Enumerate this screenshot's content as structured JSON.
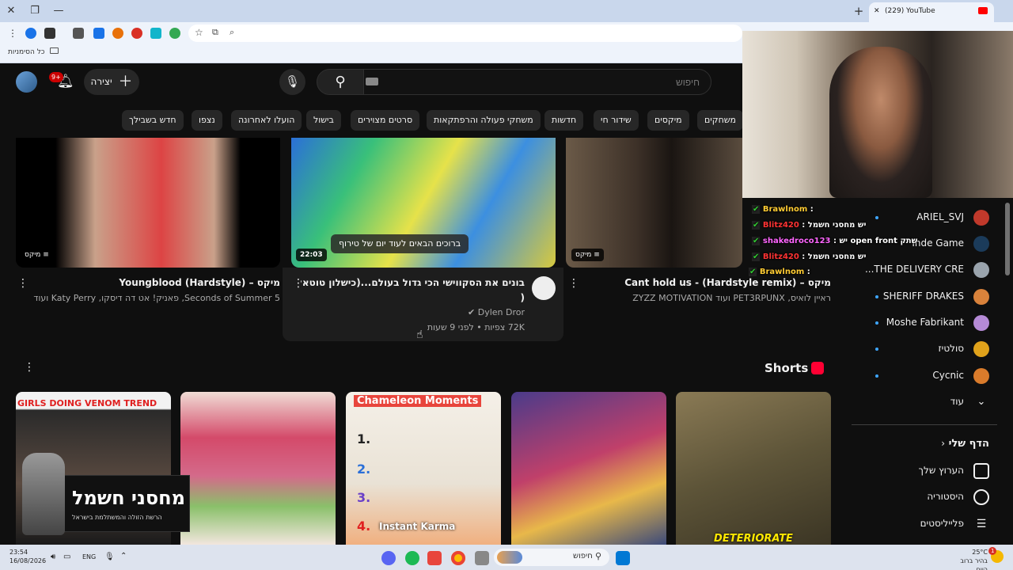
{
  "browser": {
    "tab_title": "(229) YouTube",
    "bookmarks_label": "כל הסימניות"
  },
  "header": {
    "create_label": "יצירה",
    "notification_count": "9+",
    "search_placeholder": "חיפוש"
  },
  "chips": [
    "משחקים",
    "מיקסים",
    "שידור חי",
    "חדשות",
    "משחקי פעולה והרפתקאות",
    "סרטים מצוירים",
    "בישול",
    "הועלו לאחרונה",
    "נצפו",
    "חדש בשבילך"
  ],
  "videos": [
    {
      "title": "מיקס – Cant hold us - (Hardstyle remix)",
      "subtitle": "ראיין לואיס, PET3RPUNX ועוד ZYZZ MOTIVATION",
      "badge": "מיקס"
    },
    {
      "title": "בונים את הסקווישי הכי גדול בעולם...(כישלון טוטאלי",
      "title2": "(",
      "channel": "Dylen Dror",
      "meta": "72K צפיות • לפני 9 שעות",
      "duration": "22:03",
      "caption": "ברוכים הבאים לעוד יום של טירוף"
    },
    {
      "title": "מיקס – Youngblood (Hardstyle)",
      "subtitle": "5 Seconds of Summer, פאניק! אט דה דיסקו, Katy Perry ועוד",
      "badge": "מיקס"
    }
  ],
  "shorts": {
    "title": "Shorts",
    "items": [
      {
        "overlay": "DETERIORATE"
      },
      {
        "overlay": ""
      },
      {
        "overlay_top": "Chameleon Moments",
        "overlay_bottom": "Instant Karma",
        "nums": [
          "1.",
          "2.",
          "3.",
          "4."
        ]
      },
      {
        "overlay": ""
      },
      {
        "overlay": "GIRLS DOING VENOM TREND",
        "promo_big": "מחסני חשמל",
        "promo_small": "הרשת הזולה והמשתלמת בישראל"
      }
    ]
  },
  "sidebar": {
    "subscriptions": [
      {
        "label": "ARIEL_SVJ",
        "color": "#c0392b"
      },
      {
        "label": "Inde Game",
        "color": "#1b3b5a"
      },
      {
        "label": "THE DELIVERY CRE...",
        "color": "#9aa4ad"
      },
      {
        "label": "SHERIFF DRAKES",
        "color": "#d9823b"
      },
      {
        "label": "Moshe Fabrikant",
        "color": "#b58ad6"
      },
      {
        "label": "סולטיז",
        "color": "#e0a21b"
      },
      {
        "label": "Cycnic",
        "color": "#d97b2b"
      }
    ],
    "more_label": "עוד",
    "you_title": "הדף שלי",
    "you_items": [
      "הערוץ שלך",
      "היסטוריה",
      "פלייליסטים"
    ]
  },
  "stream_chat": [
    {
      "user": "Brawlnom",
      "text": "",
      "color": "#ffcc33"
    },
    {
      "user": "Blitz420",
      "text": "יש מחסני חשמל",
      "color": "#ff3333"
    },
    {
      "user": "shakedroco123",
      "text": "יש open front שתק",
      "color": "#ff66ff"
    },
    {
      "user": "Blitz420",
      "text": "יש מחסני חשמל",
      "color": "#ff3333"
    },
    {
      "user": "Brawlnom",
      "text": "",
      "color": "#ffcc33"
    }
  ],
  "taskbar": {
    "time": "23:54",
    "date": "16/08/2026",
    "lang": "ENG",
    "search_label": "חיפוש",
    "weather_temp": "25°C",
    "weather_desc": "בהיר ברוב היום",
    "weather_badge": "1"
  }
}
